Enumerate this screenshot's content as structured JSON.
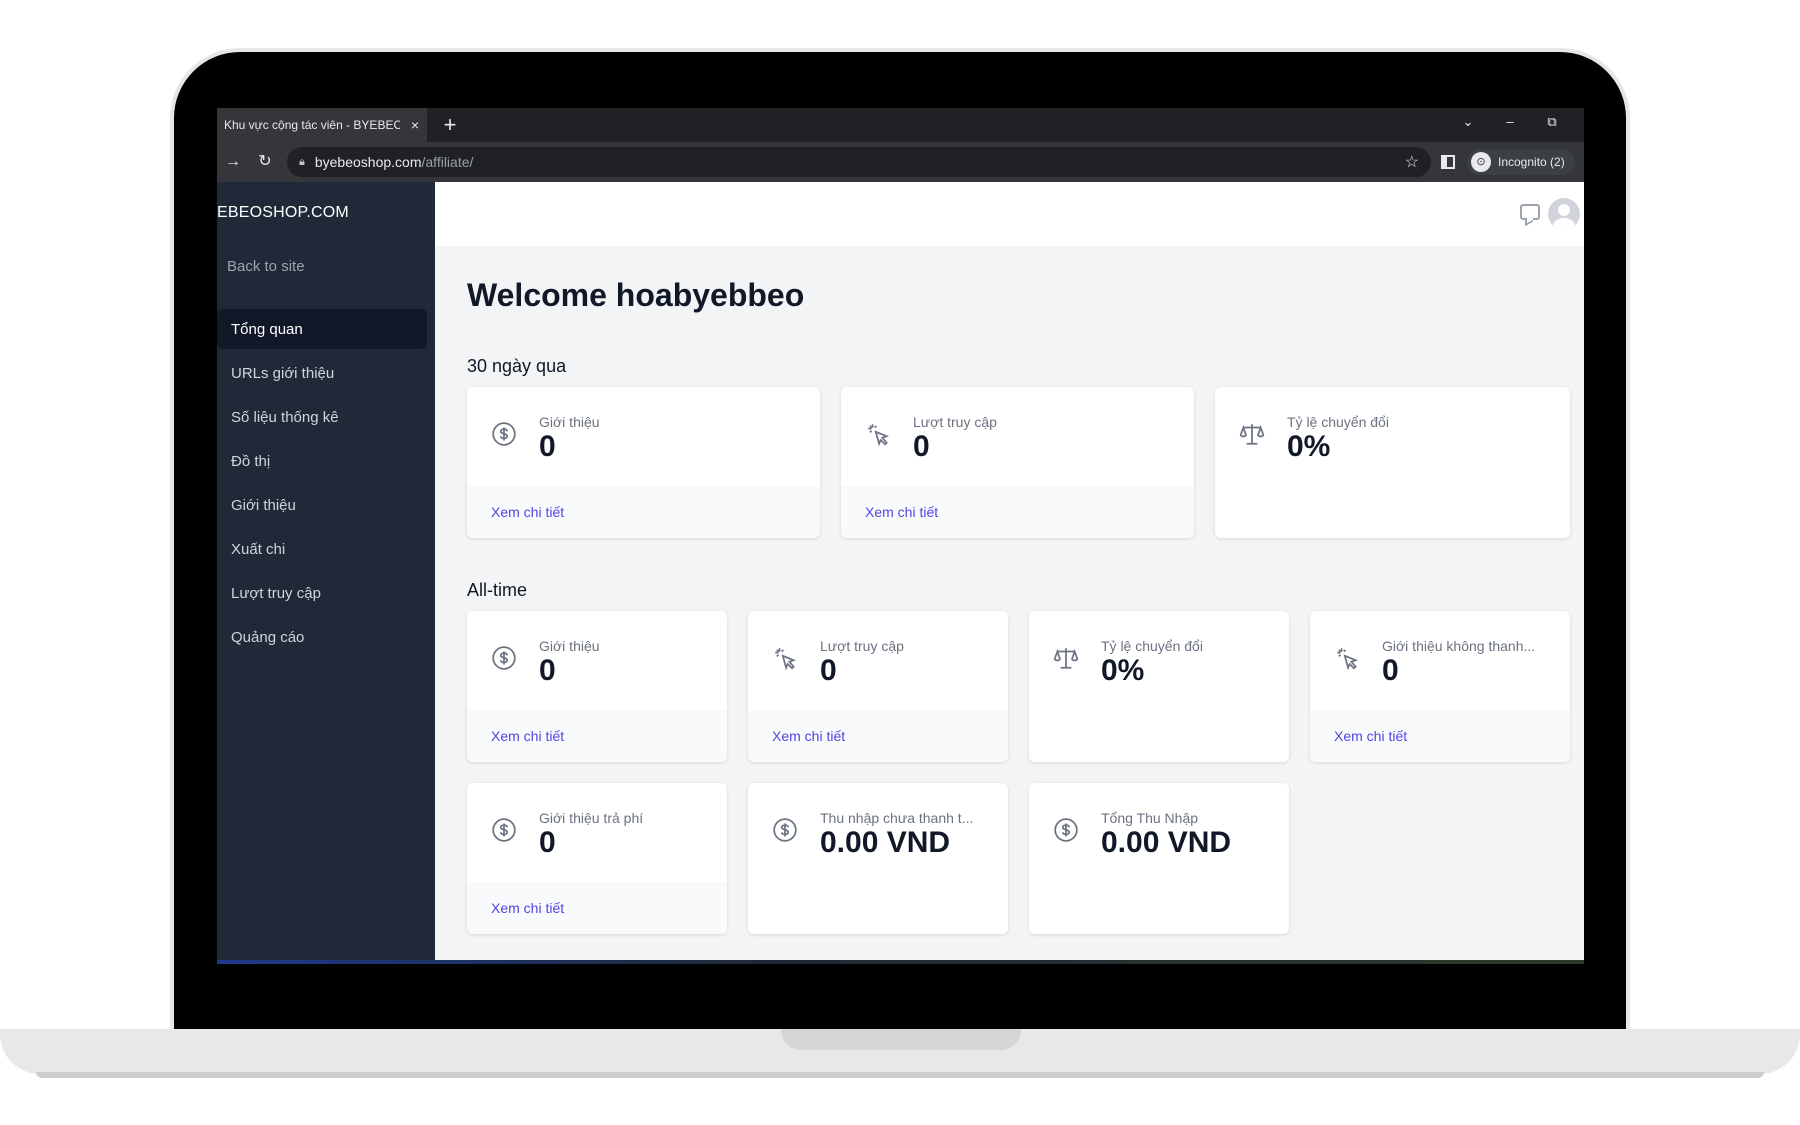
{
  "browser": {
    "tab_title": "Khu vực cộng tác viên - BYEBEOSHOP",
    "tab_close": "×",
    "new_tab": "+",
    "url_host": "byebeoshop.com",
    "url_path": "/affiliate/",
    "incognito_label": "Incognito (2)"
  },
  "sidebar": {
    "brand": "EBEOSHOP.COM",
    "back_link": "Back to site",
    "items": [
      {
        "label": "Tổng quan",
        "active": true
      },
      {
        "label": "URLs giới thiệu"
      },
      {
        "label": "Số liệu thống kê"
      },
      {
        "label": "Đồ thị"
      },
      {
        "label": "Giới thiệu"
      },
      {
        "label": "Xuất chi"
      },
      {
        "label": "Lượt truy cập"
      },
      {
        "label": "Quảng cáo"
      }
    ]
  },
  "main": {
    "welcome": "Welcome hoabyebbeo",
    "section_30_days": "30 ngày qua",
    "section_all_time": "All-time",
    "link_text": "Xem chi tiết",
    "cards_30": [
      {
        "icon": "dollar-icon",
        "label": "Giới thiệu",
        "value": "0"
      },
      {
        "icon": "cursor-click-icon",
        "label": "Lượt truy cập",
        "value": "0"
      },
      {
        "icon": "scale-icon",
        "label": "Tỷ lệ chuyển đổi",
        "value": "0%"
      }
    ],
    "cards_all": [
      {
        "icon": "dollar-icon",
        "label": "Giới thiệu",
        "value": "0"
      },
      {
        "icon": "cursor-click-icon",
        "label": "Lượt truy cập",
        "value": "0"
      },
      {
        "icon": "scale-icon",
        "label": "Tỷ lệ chuyển đổi",
        "value": "0%"
      },
      {
        "icon": "cursor-click-icon",
        "label": "Giới thiệu không thanh...",
        "value": "0"
      },
      {
        "icon": "dollar-icon",
        "label": "Giới thiệu trả phí",
        "value": "0"
      },
      {
        "icon": "dollar-icon",
        "label": "Thu nhập chưa thanh t...",
        "value": "0.00 VND"
      },
      {
        "icon": "dollar-icon",
        "label": "Tổng Thu Nhập",
        "value": "0.00 VND"
      }
    ]
  }
}
